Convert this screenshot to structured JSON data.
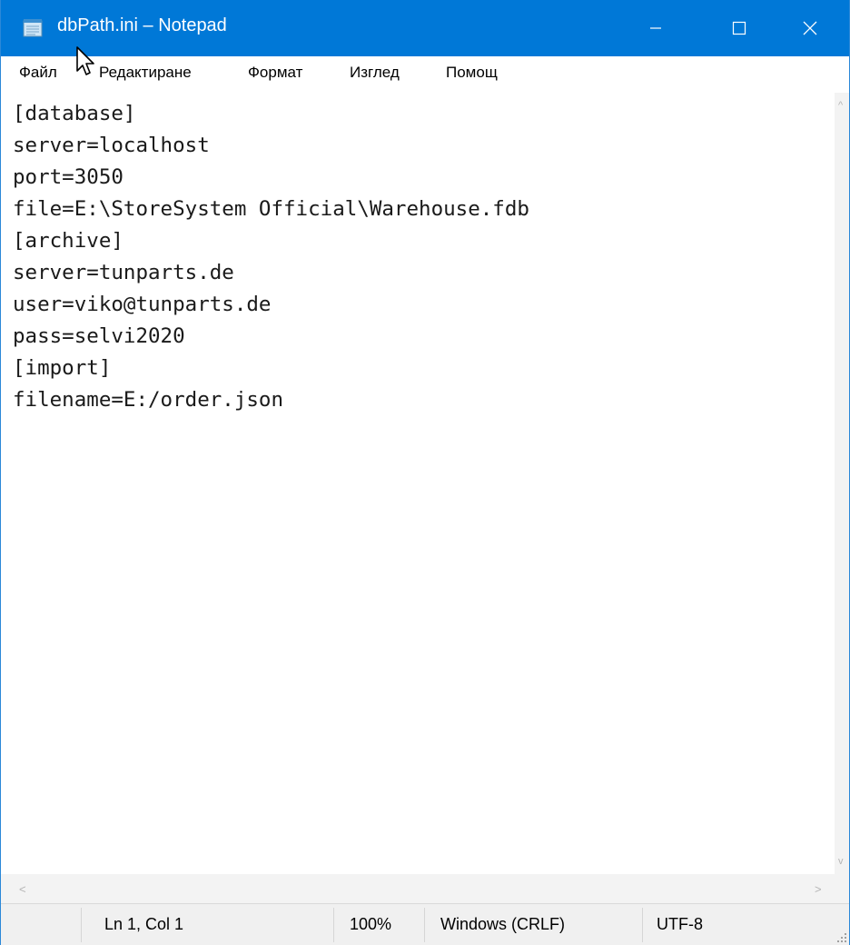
{
  "window": {
    "title": "dbPath.ini – Notepad"
  },
  "controls": {
    "minimize": "—",
    "maximize": "☐",
    "close": "✕"
  },
  "menu": [
    "Файл",
    "Редактиране",
    "Формат",
    "Изглед",
    "Помощ"
  ],
  "editor": {
    "lines": [
      "[database]",
      "server=localhost",
      "port=3050",
      "file=E:\\StoreSystem Official\\Warehouse.fdb",
      "[archive]",
      "server=tunparts.de",
      "user=viko@tunparts.de",
      "pass=selvi2020",
      "[import]",
      "filename=E:/order.json"
    ]
  },
  "scrollbar": {
    "up": "^",
    "down": "v",
    "left": "<",
    "right": ">"
  },
  "status": {
    "position": "Ln 1, Col 1",
    "zoom": "100%",
    "line_ending": "Windows (CRLF)",
    "encoding": "UTF-8"
  },
  "colors": {
    "titlebar": "#0078d7",
    "statusbar": "#f0f0f0"
  },
  "icons": {
    "app": "notepad-icon",
    "pointer": "mouse-pointer-icon"
  }
}
